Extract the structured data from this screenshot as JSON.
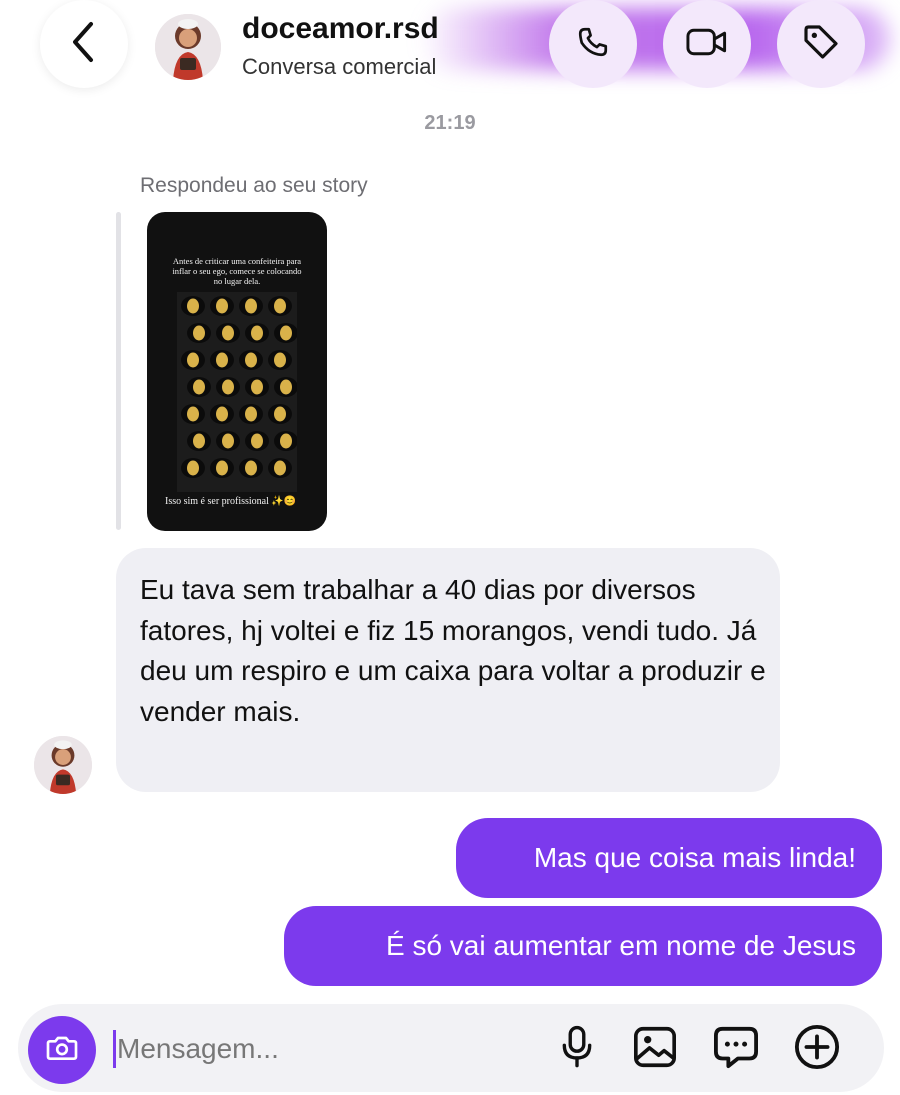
{
  "header": {
    "username": "doceamor.rsd",
    "subtitle": "Conversa comercial",
    "icons": {
      "back": "chevron-left-icon",
      "call": "phone-icon",
      "video": "video-camera-icon",
      "label": "tag-icon"
    }
  },
  "thread": {
    "timestamp": "21:19",
    "story_reply_label": "Respondeu ao seu story",
    "story": {
      "top_text": "Antes de criticar uma confeiteira para inflar o seu ego, comece se colocando no lugar dela.",
      "bottom_text": "Isso sim é ser profissional ✨😊"
    },
    "incoming": [
      {
        "text": "Eu tava sem trabalhar a 40 dias por diversos fatores, hj voltei e fiz 15 morangos, vendi tudo. Já deu um respiro e um caixa para voltar a produzir e vender mais."
      }
    ],
    "outgoing": [
      {
        "text": "Mas que coisa mais linda!"
      },
      {
        "text": "É só vai aumentar em nome de Jesus"
      }
    ]
  },
  "composer": {
    "placeholder": "Mensagem...",
    "value": "",
    "icons": [
      "camera-icon",
      "microphone-icon",
      "gallery-icon",
      "sticker-icon",
      "plus-icon"
    ]
  },
  "colors": {
    "accent": "#7c3aed",
    "incoming_bubble": "#efeff4",
    "header_glow": "#b45ee8"
  }
}
